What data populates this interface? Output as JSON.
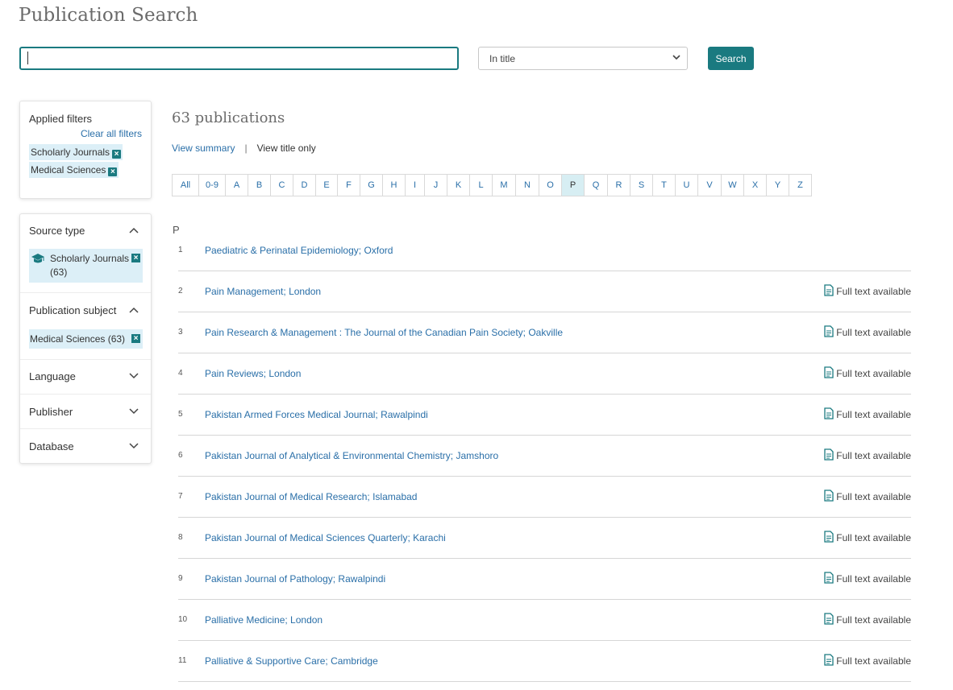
{
  "page": {
    "title": "Publication Search"
  },
  "search": {
    "value": "",
    "placeholder": "",
    "scope_selected": "In title",
    "button_label": "Search"
  },
  "applied_filters": {
    "title": "Applied filters",
    "clear_label": "Clear all filters",
    "chips": [
      "Scholarly Journals",
      "Medical Sciences"
    ]
  },
  "facets": {
    "source_type": {
      "label": "Source type",
      "chip_label": "Scholarly Journals",
      "chip_count": "(63)",
      "chip_icon": "graduation-cap-icon"
    },
    "publication_subject": {
      "label": "Publication subject",
      "chip_label": "Medical Sciences (63)"
    },
    "language": {
      "label": "Language"
    },
    "publisher": {
      "label": "Publisher"
    },
    "database": {
      "label": "Database"
    }
  },
  "results": {
    "count_label": "63 publications",
    "view_summary": "View summary",
    "separator": "|",
    "view_title_only": "View title only",
    "section_letter": "P",
    "fulltext_label": "Full text available",
    "items": [
      {
        "num": "1",
        "title": "Paediatric & Perinatal Epidemiology; Oxford",
        "fulltext": false
      },
      {
        "num": "2",
        "title": "Pain Management; London",
        "fulltext": true
      },
      {
        "num": "3",
        "title": "Pain Research & Management : The Journal of the Canadian Pain Society; Oakville",
        "fulltext": true
      },
      {
        "num": "4",
        "title": "Pain Reviews; London",
        "fulltext": true
      },
      {
        "num": "5",
        "title": "Pakistan Armed Forces Medical Journal; Rawalpindi",
        "fulltext": true
      },
      {
        "num": "6",
        "title": "Pakistan Journal of Analytical & Environmental Chemistry; Jamshoro",
        "fulltext": true
      },
      {
        "num": "7",
        "title": "Pakistan Journal of Medical Research; Islamabad",
        "fulltext": true
      },
      {
        "num": "8",
        "title": "Pakistan Journal of Medical Sciences Quarterly; Karachi",
        "fulltext": true
      },
      {
        "num": "9",
        "title": "Pakistan Journal of Pathology; Rawalpindi",
        "fulltext": true
      },
      {
        "num": "10",
        "title": "Palliative Medicine; London",
        "fulltext": true
      },
      {
        "num": "11",
        "title": "Palliative & Supportive Care; Cambridge",
        "fulltext": true
      }
    ]
  },
  "alphabet": {
    "letters": [
      "All",
      "0-9",
      "A",
      "B",
      "C",
      "D",
      "E",
      "F",
      "G",
      "H",
      "I",
      "J",
      "K",
      "L",
      "M",
      "N",
      "O",
      "P",
      "Q",
      "R",
      "S",
      "T",
      "U",
      "V",
      "W",
      "X",
      "Y",
      "Z"
    ],
    "active": "P"
  },
  "colors": {
    "accent": "#1a7a80",
    "link": "#2a6fa8",
    "chip_bg": "#dceff7",
    "active_letter_bg": "#d7eef3"
  }
}
